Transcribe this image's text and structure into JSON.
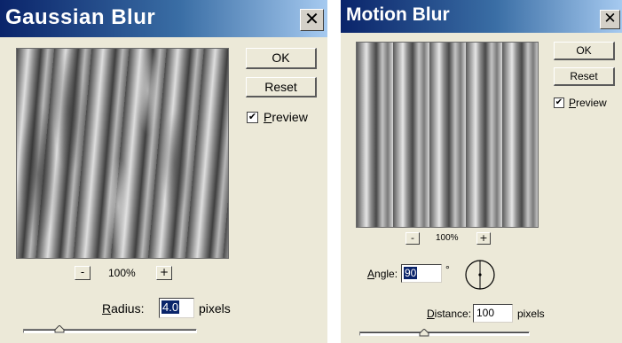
{
  "gaussian": {
    "title": "Gaussian Blur",
    "close_glyph": "✕",
    "ok_label": "OK",
    "reset_label": "Reset",
    "preview_checked": "✔",
    "preview_mnemonic": "P",
    "preview_rest": "review",
    "zoom_minus": "-",
    "zoom_plus": "+",
    "zoom_level": "100%",
    "radius_mnemonic": "R",
    "radius_rest": "adius:",
    "radius_value": "4.0",
    "radius_unit": "pixels",
    "slider_fraction": 0.2
  },
  "motion": {
    "title": "Motion Blur",
    "close_glyph": "✕",
    "ok_label": "OK",
    "reset_label": "Reset",
    "preview_checked": "✔",
    "preview_mnemonic": "P",
    "preview_rest": "review",
    "zoom_minus": "-",
    "zoom_plus": "+",
    "zoom_level": "100%",
    "angle_mnemonic": "A",
    "angle_rest": "ngle:",
    "angle_value": "90",
    "angle_degree": "°",
    "distance_mnemonic": "D",
    "distance_rest": "istance:",
    "distance_value": "100",
    "distance_unit": "pixels",
    "slider_fraction": 0.38
  },
  "colors": {
    "dialog_face": "#ece9d8",
    "titlebar_start": "#0a246a",
    "titlebar_end": "#a6caf0",
    "selection": "#0a246a"
  },
  "icons": {
    "close": "close-icon",
    "check": "checkmark-icon",
    "dial": "angle-dial-icon",
    "thumb": "slider-thumb-icon"
  }
}
